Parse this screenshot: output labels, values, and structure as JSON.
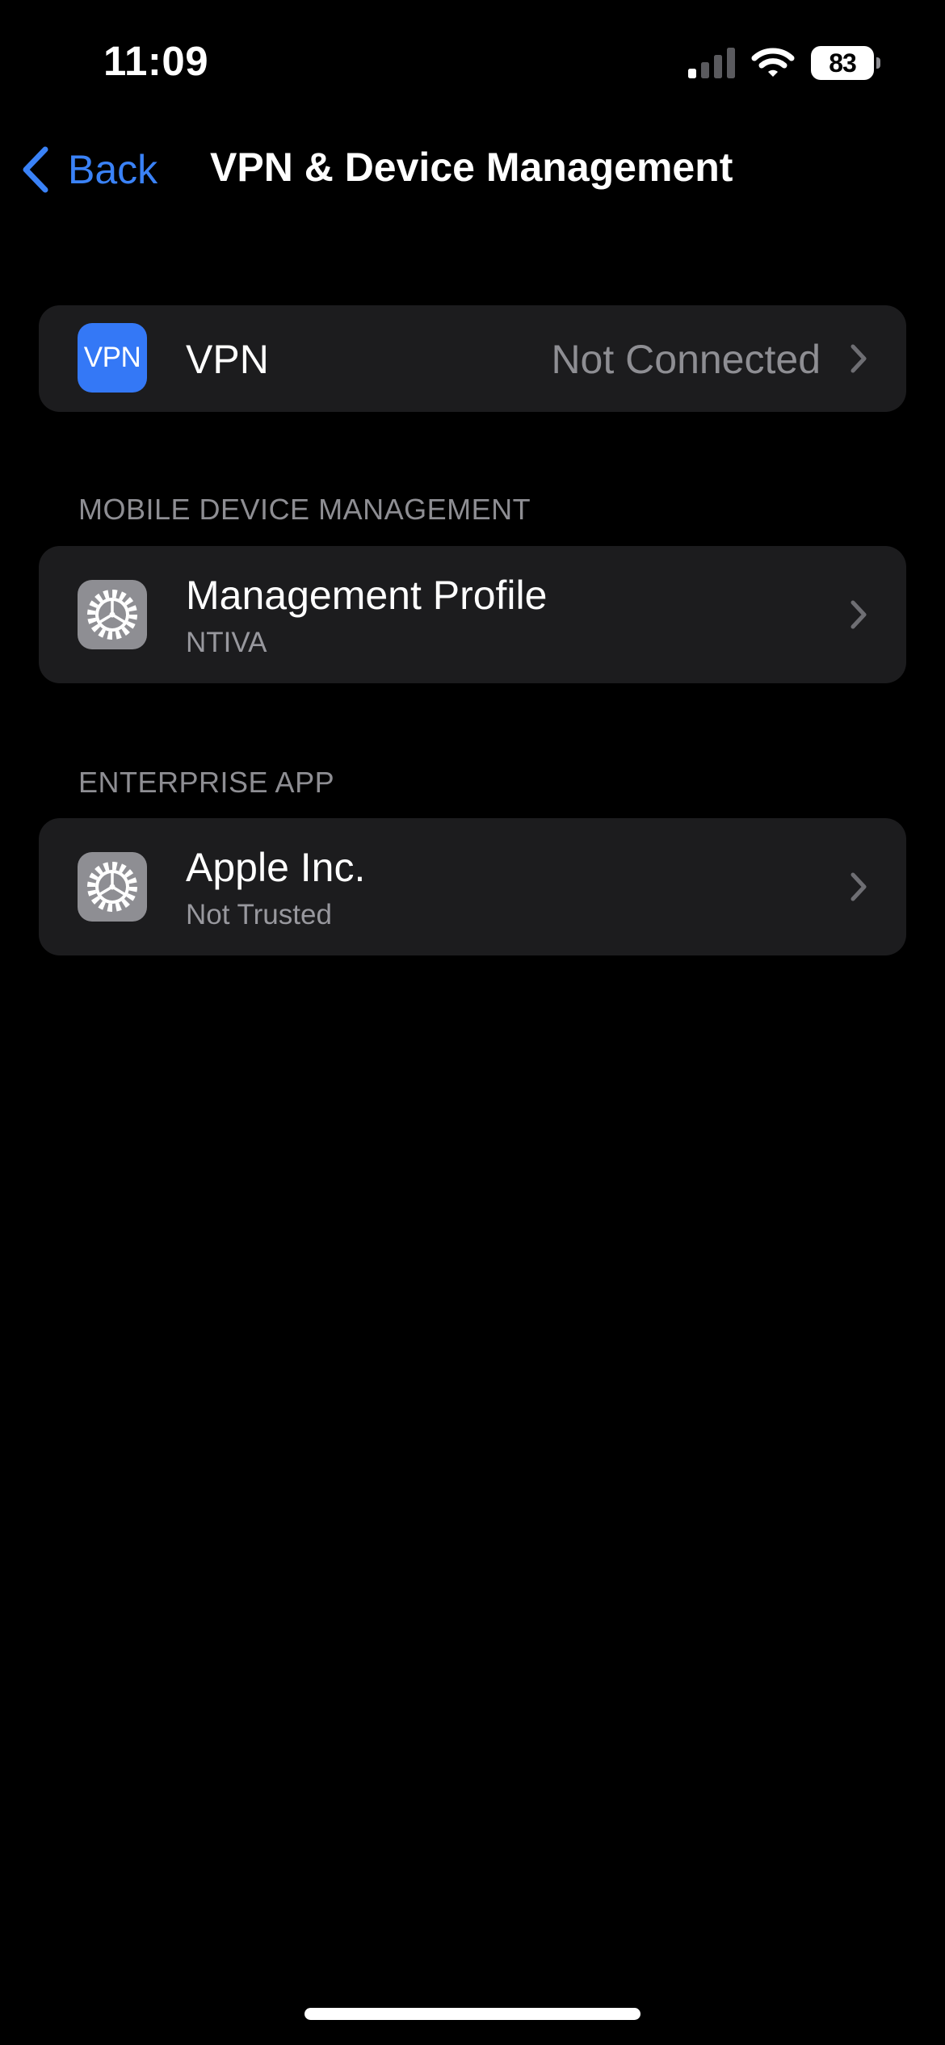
{
  "status_bar": {
    "time": "11:09",
    "battery_level": "83",
    "icons": [
      "signal-icon",
      "wifi-icon",
      "battery-icon"
    ]
  },
  "nav": {
    "back_label": "Back",
    "title": "VPN & Device Management"
  },
  "vpn_row": {
    "icon_label": "VPN",
    "title": "VPN",
    "value": "Not Connected"
  },
  "mdm_section": {
    "header": "MOBILE DEVICE MANAGEMENT",
    "row": {
      "title": "Management Profile",
      "subtitle": "NTIVA"
    }
  },
  "enterprise_section": {
    "header": "ENTERPRISE APP",
    "row": {
      "title": "Apple Inc.",
      "subtitle": "Not Trusted"
    }
  },
  "colors": {
    "background": "#000000",
    "cell": "#1c1c1e",
    "accent": "#3a82f7",
    "vpn_icon": "#3478f6",
    "secondary_text": "#8e8e93"
  }
}
